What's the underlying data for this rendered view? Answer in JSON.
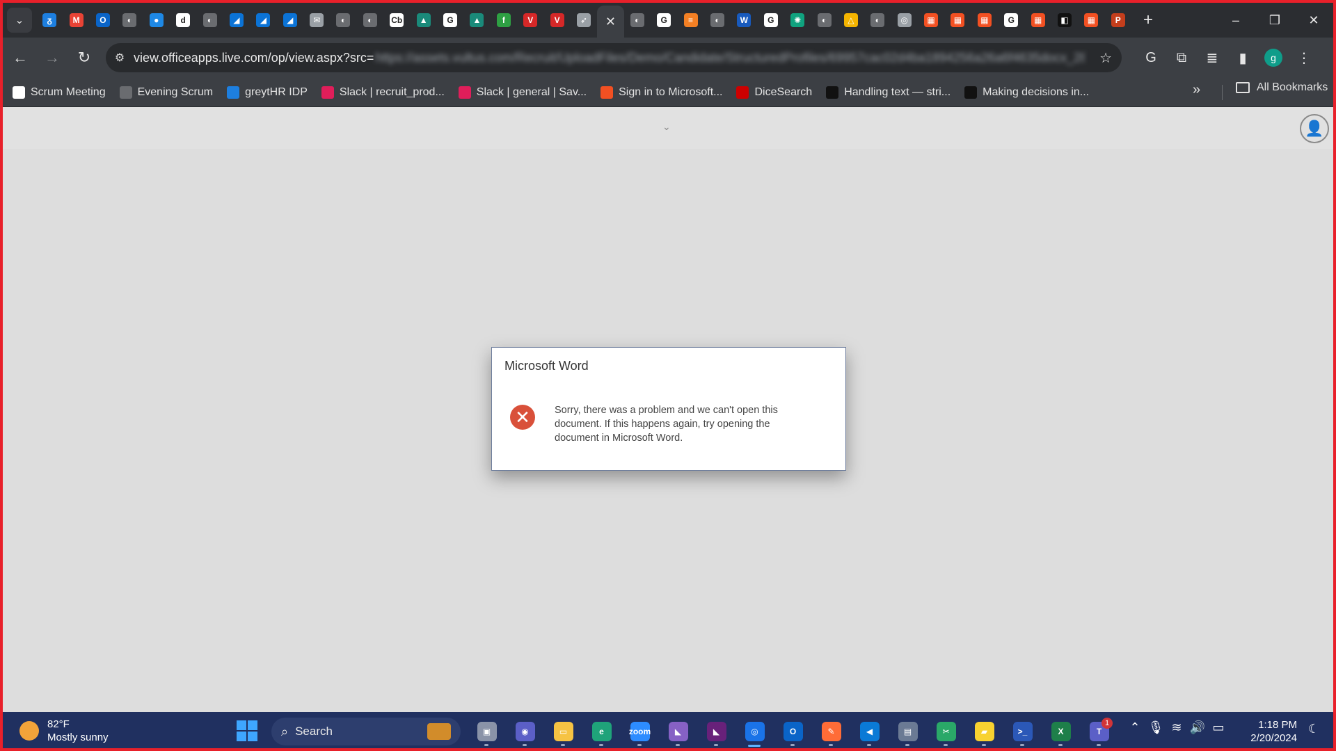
{
  "browser": {
    "tabs": [
      {
        "icon": "chrome-menu-icon",
        "color": "#3a3c41"
      },
      {
        "icon": "greythr-icon",
        "color": "#1d7fe0",
        "glyph": "ᵹ"
      },
      {
        "icon": "gmail-icon",
        "color": "#e84335",
        "glyph": "M"
      },
      {
        "icon": "outlook-icon",
        "color": "#0a64c8",
        "glyph": "O"
      },
      {
        "icon": "globe-icon",
        "color": "#6a6c70",
        "glyph": "◐"
      },
      {
        "icon": "blue-circle-icon",
        "color": "#1e88e5",
        "glyph": "●"
      },
      {
        "icon": "document-icon",
        "color": "#ffffff",
        "glyph": "d"
      },
      {
        "icon": "globe-icon",
        "color": "#6a6c70",
        "glyph": "◐"
      },
      {
        "icon": "azure-devops-icon",
        "color": "#0b73d6",
        "glyph": "◢"
      },
      {
        "icon": "azure-devops-icon",
        "color": "#0b73d6",
        "glyph": "◢"
      },
      {
        "icon": "azure-devops-icon",
        "color": "#0b73d6",
        "glyph": "◢"
      },
      {
        "icon": "mail-icon",
        "color": "#9aa0a6",
        "glyph": "✉"
      },
      {
        "icon": "globe-icon",
        "color": "#6a6c70",
        "glyph": "◐"
      },
      {
        "icon": "globe-icon",
        "color": "#6a6c70",
        "glyph": "◐"
      },
      {
        "icon": "crunchbase-icon",
        "color": "#ffffff",
        "glyph": "Cb"
      },
      {
        "icon": "mountain-icon",
        "color": "#1a8a7a",
        "glyph": "▲"
      },
      {
        "icon": "google-icon",
        "color": "#ffffff",
        "glyph": "G"
      },
      {
        "icon": "mountain-icon",
        "color": "#1a8a7a",
        "glyph": "▲"
      },
      {
        "icon": "green-leaf-icon",
        "color": "#2ea043",
        "glyph": "f"
      },
      {
        "icon": "red-v-icon",
        "color": "#d62828",
        "glyph": "V"
      },
      {
        "icon": "red-v-icon",
        "color": "#d62828",
        "glyph": "V"
      },
      {
        "icon": "rocket-icon",
        "color": "#9aa0a6",
        "glyph": "➶"
      },
      {
        "icon": "close-icon",
        "color": "#3c3f44",
        "glyph": "✕",
        "active": true
      },
      {
        "icon": "globe-icon",
        "color": "#6a6c70",
        "glyph": "◐"
      },
      {
        "icon": "google-icon",
        "color": "#ffffff",
        "glyph": "G"
      },
      {
        "icon": "stackoverflow-icon",
        "color": "#f48024",
        "glyph": "≡"
      },
      {
        "icon": "globe-icon",
        "color": "#6a6c70",
        "glyph": "◐"
      },
      {
        "icon": "word-icon",
        "color": "#185abd",
        "glyph": "W"
      },
      {
        "icon": "google-icon",
        "color": "#ffffff",
        "glyph": "G"
      },
      {
        "icon": "chatgpt-icon",
        "color": "#10a37f",
        "glyph": "✺"
      },
      {
        "icon": "globe-icon",
        "color": "#6a6c70",
        "glyph": "◐"
      },
      {
        "icon": "google-drive-icon",
        "color": "#f4b400",
        "glyph": "△"
      },
      {
        "icon": "globe-icon",
        "color": "#6a6c70",
        "glyph": "◐"
      },
      {
        "icon": "chrome-icon",
        "color": "#9aa0a6",
        "glyph": "◎"
      },
      {
        "icon": "microsoft-icon",
        "color": "#f25022",
        "glyph": "▦"
      },
      {
        "icon": "microsoft-icon",
        "color": "#f25022",
        "glyph": "▦"
      },
      {
        "icon": "microsoft-icon",
        "color": "#f25022",
        "glyph": "▦"
      },
      {
        "icon": "google-icon",
        "color": "#ffffff",
        "glyph": "G"
      },
      {
        "icon": "microsoft-icon",
        "color": "#f25022",
        "glyph": "▦"
      },
      {
        "icon": "black-app-icon",
        "color": "#111111",
        "glyph": "◧"
      },
      {
        "icon": "microsoft-icon",
        "color": "#f25022",
        "glyph": "▦"
      },
      {
        "icon": "powerpoint-icon",
        "color": "#c43e1c",
        "glyph": "P"
      }
    ],
    "url_host": "view.officeapps.live.com/op/view.aspx?src=",
    "url_rest": "https://assets.vultus.com/Recruit/UploadFiles/Demo/Candidate/StructuredProfiles/69957cac02d4ba1894256a26a6f4635docx_280220...",
    "profile_initial": "g"
  },
  "bookmarks": [
    {
      "label": "Scrum Meeting",
      "icon": "google-icon",
      "color": "#ffffff"
    },
    {
      "label": "Evening Scrum",
      "icon": "globe-icon",
      "color": "#6a6c70"
    },
    {
      "label": "greytHR IDP",
      "icon": "greythr-icon",
      "color": "#1d7fe0"
    },
    {
      "label": "Slack | recruit_prod...",
      "icon": "slack-icon",
      "color": "#e01e5a"
    },
    {
      "label": "Slack | general | Sav...",
      "icon": "slack-icon",
      "color": "#e01e5a"
    },
    {
      "label": "Sign in to Microsoft...",
      "icon": "microsoft-icon",
      "color": "#f25022"
    },
    {
      "label": "DiceSearch",
      "icon": "dice-icon",
      "color": "#cc0000"
    },
    {
      "label": "Handling text — stri...",
      "icon": "mdn-icon",
      "color": "#111111"
    },
    {
      "label": "Making decisions in...",
      "icon": "mdn-icon",
      "color": "#111111"
    }
  ],
  "all_bookmarks_label": "All Bookmarks",
  "dialog": {
    "title": "Microsoft Word",
    "message": "Sorry, there was a problem and we can't open this document. If this happens again, try opening the document in Microsoft Word."
  },
  "taskbar": {
    "weather_temp": "82°F",
    "weather_desc": "Mostly sunny",
    "search_label": "Search",
    "apps": [
      {
        "icon": "task-view-icon",
        "color": "#8a93a8",
        "glyph": "▣"
      },
      {
        "icon": "teams-meet-icon",
        "color": "#5b5fc7",
        "glyph": "◉"
      },
      {
        "icon": "file-explorer-icon",
        "color": "#f6c343",
        "glyph": "▭"
      },
      {
        "icon": "edge-icon",
        "color": "#1fa37a",
        "glyph": "e"
      },
      {
        "icon": "zoom-icon",
        "color": "#2d8cff",
        "glyph": "zoom"
      },
      {
        "icon": "visual-studio-icon",
        "color": "#8661c5",
        "glyph": "◣"
      },
      {
        "icon": "visual-studio-icon",
        "color": "#68217a",
        "glyph": "◣"
      },
      {
        "icon": "chrome-icon",
        "color": "#1a73e8",
        "glyph": "◎",
        "active": true
      },
      {
        "icon": "outlook-icon",
        "color": "#0a64c8",
        "glyph": "O"
      },
      {
        "icon": "postman-icon",
        "color": "#ff6c37",
        "glyph": "✎"
      },
      {
        "icon": "vscode-icon",
        "color": "#0a7ad6",
        "glyph": "◀"
      },
      {
        "icon": "server-manager-icon",
        "color": "#6b7a94",
        "glyph": "▤"
      },
      {
        "icon": "snipping-tool-icon",
        "color": "#2aa868",
        "glyph": "✂"
      },
      {
        "icon": "sticky-notes-icon",
        "color": "#f8d230",
        "glyph": "▰"
      },
      {
        "icon": "terminal-icon",
        "color": "#2b58b8",
        "glyph": ">_"
      },
      {
        "icon": "excel-like-icon",
        "color": "#1e7f4a",
        "glyph": "X"
      },
      {
        "icon": "teams-icon",
        "color": "#5b5fc7",
        "glyph": "T",
        "badge": "1"
      }
    ],
    "time": "1:18 PM",
    "date": "2/20/2024"
  }
}
